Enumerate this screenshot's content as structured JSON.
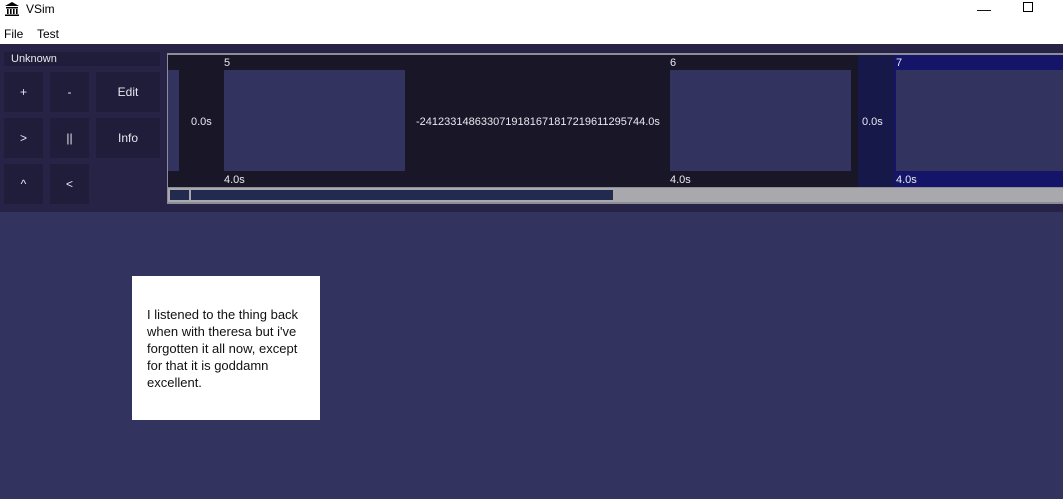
{
  "window": {
    "title": "VSim",
    "minimize_label": "—"
  },
  "menu": {
    "items": [
      "File",
      "Test"
    ]
  },
  "controls": {
    "label": "Unknown",
    "buttons": {
      "plus": "+",
      "minus": "-",
      "edit": "Edit",
      "play": ">",
      "pause": "||",
      "info": "Info",
      "up": "^",
      "back": "<"
    }
  },
  "timeline": {
    "slides": [
      {
        "number": "5",
        "transition": "0.0s",
        "duration": "4.0s"
      },
      {
        "number": "6",
        "transition": "-241233148633071918167181721961129574 4.0s",
        "duration": "4.0s"
      },
      {
        "number": "7",
        "transition": "0.0s",
        "duration": "4.0s"
      }
    ],
    "transition_6": "-2412331486330719181671817219611295744.0s"
  },
  "note": {
    "text": "I listened to the thing back when with theresa but i've forgotten it all now, except for that it is goddamn excellent."
  },
  "colors": {
    "background": "#33335f",
    "panel": "#262347",
    "button": "#1f1d3a",
    "selected_slide": "#141568"
  }
}
